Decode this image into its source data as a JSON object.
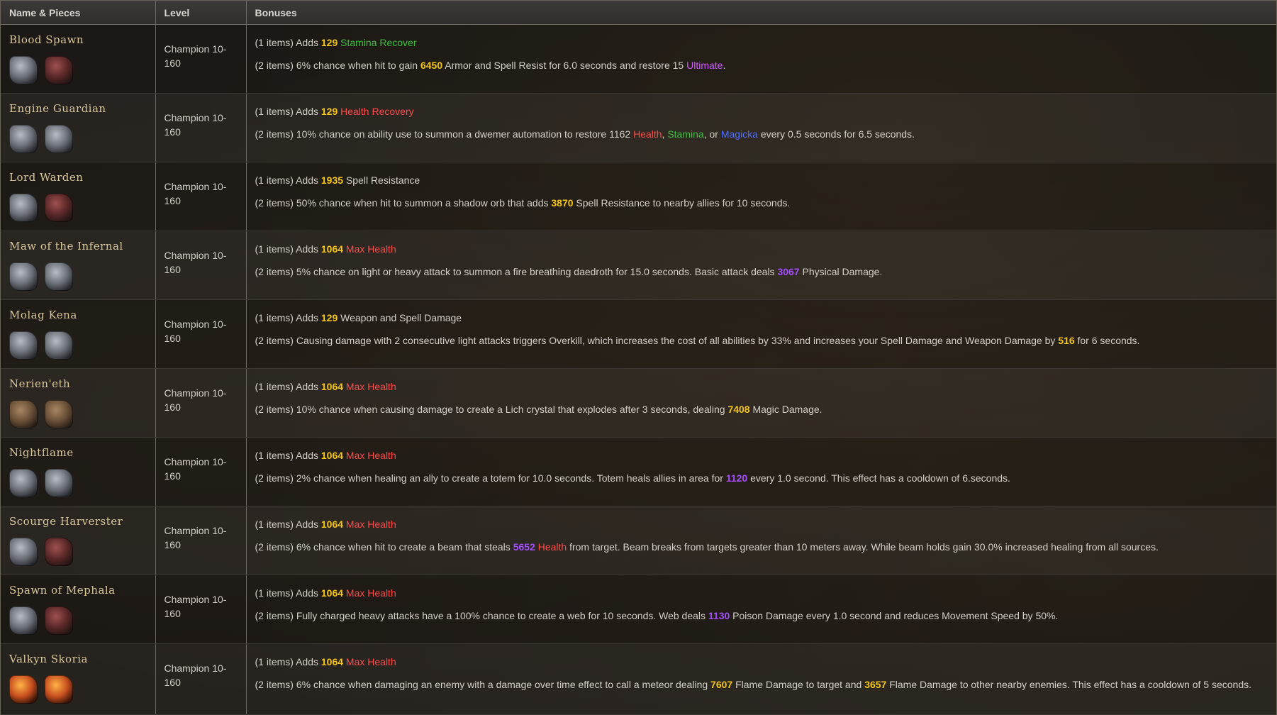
{
  "headers": {
    "name": "Name & Pieces",
    "level": "Level",
    "bonuses": "Bonuses"
  },
  "colors": {
    "number": "#f5c518",
    "number_alt": "#a44dff",
    "stamina": "#3fbf3f",
    "health": "#ff4a4a",
    "magicka": "#4f6bff",
    "ultimate": "#d05bff",
    "set_name": "#d9c79a"
  },
  "sets": [
    {
      "name": "Blood Spawn",
      "level": "Champion 10-160",
      "pieces": [
        {
          "icon": "helm-icon",
          "tone": "steel"
        },
        {
          "icon": "shoulder-icon",
          "tone": "red"
        }
      ],
      "bonuses": [
        [
          {
            "t": "(1 items) Adds "
          },
          {
            "t": "129",
            "c": "num"
          },
          {
            "t": " "
          },
          {
            "t": "Stamina Recover",
            "c": "t-green"
          }
        ],
        [
          {
            "t": "(2 items) 6% chance when hit to gain "
          },
          {
            "t": "6450",
            "c": "num"
          },
          {
            "t": " Armor and Spell Resist for 6.0 seconds and restore 15 "
          },
          {
            "t": "Ultimate",
            "c": "t-magenta"
          },
          {
            "t": "."
          }
        ]
      ]
    },
    {
      "name": "Engine Guardian",
      "level": "Champion 10-160",
      "pieces": [
        {
          "icon": "helm-icon",
          "tone": "steel"
        },
        {
          "icon": "shoulder-icon",
          "tone": "steel"
        }
      ],
      "bonuses": [
        [
          {
            "t": "(1 items) Adds "
          },
          {
            "t": "129",
            "c": "num"
          },
          {
            "t": " "
          },
          {
            "t": "Health Recovery",
            "c": "t-red"
          }
        ],
        [
          {
            "t": "(2 items) 10% chance on ability use to summon a dwemer automation to restore 1162 "
          },
          {
            "t": "Health",
            "c": "t-red"
          },
          {
            "t": ", "
          },
          {
            "t": "Stamina",
            "c": "t-green"
          },
          {
            "t": ", or "
          },
          {
            "t": "Magicka",
            "c": "t-blue"
          },
          {
            "t": " every 0.5 seconds for 6.5 seconds."
          }
        ]
      ]
    },
    {
      "name": "Lord Warden",
      "level": "Champion 10-160",
      "pieces": [
        {
          "icon": "helm-icon",
          "tone": "steel"
        },
        {
          "icon": "shoulder-icon",
          "tone": "red"
        }
      ],
      "bonuses": [
        [
          {
            "t": "(1 items) Adds "
          },
          {
            "t": "1935",
            "c": "num"
          },
          {
            "t": " Spell Resistance"
          }
        ],
        [
          {
            "t": "(2 items) 50% chance when hit to summon a shadow orb that adds "
          },
          {
            "t": "3870",
            "c": "num"
          },
          {
            "t": " Spell Resistance to nearby allies for 10 seconds."
          }
        ]
      ]
    },
    {
      "name": "Maw of the Infernal",
      "level": "Champion 10-160",
      "pieces": [
        {
          "icon": "helm-icon",
          "tone": "steel"
        },
        {
          "icon": "shoulder-icon",
          "tone": "steel"
        }
      ],
      "bonuses": [
        [
          {
            "t": "(1 items) Adds "
          },
          {
            "t": "1064",
            "c": "num"
          },
          {
            "t": " "
          },
          {
            "t": "Max Health",
            "c": "t-red"
          }
        ],
        [
          {
            "t": "(2 items) 5% chance on light or heavy attack to summon a fire breathing daedroth for 15.0 seconds. Basic attack deals "
          },
          {
            "t": "3067",
            "c": "num-purple"
          },
          {
            "t": " Physical Damage."
          }
        ]
      ]
    },
    {
      "name": "Molag Kena",
      "level": "Champion 10-160",
      "pieces": [
        {
          "icon": "helm-icon",
          "tone": "steel"
        },
        {
          "icon": "shoulder-icon",
          "tone": "steel"
        }
      ],
      "bonuses": [
        [
          {
            "t": "(1 items) Adds "
          },
          {
            "t": "129",
            "c": "num"
          },
          {
            "t": " Weapon and Spell Damage"
          }
        ],
        [
          {
            "t": "(2 items) Causing damage with 2 consecutive light attacks triggers Overkill, which increases the cost of all abilities by 33% and increases your Spell Damage and Weapon Damage by "
          },
          {
            "t": "516",
            "c": "num"
          },
          {
            "t": " for 6 seconds."
          }
        ]
      ]
    },
    {
      "name": "Nerien'eth",
      "level": "Champion 10-160",
      "pieces": [
        {
          "icon": "helm-icon",
          "tone": "brown"
        },
        {
          "icon": "shoulder-icon",
          "tone": "brown"
        }
      ],
      "bonuses": [
        [
          {
            "t": "(1 items) Adds "
          },
          {
            "t": "1064",
            "c": "num"
          },
          {
            "t": " "
          },
          {
            "t": "Max Health",
            "c": "t-red"
          }
        ],
        [
          {
            "t": "(2 items) 10% chance when causing damage to create a Lich crystal that explodes after 3 seconds, dealing "
          },
          {
            "t": "7408",
            "c": "num"
          },
          {
            "t": " Magic Damage."
          }
        ]
      ]
    },
    {
      "name": "Nightflame",
      "level": "Champion 10-160",
      "pieces": [
        {
          "icon": "helm-icon",
          "tone": "steel"
        },
        {
          "icon": "shoulder-icon",
          "tone": "steel"
        }
      ],
      "bonuses": [
        [
          {
            "t": "(1 items) Adds "
          },
          {
            "t": "1064",
            "c": "num"
          },
          {
            "t": " "
          },
          {
            "t": "Max Health",
            "c": "t-red"
          }
        ],
        [
          {
            "t": "(2 items) 2% chance when healing an ally to create a totem for 10.0 seconds. Totem heals allies in area for "
          },
          {
            "t": "1120",
            "c": "num-purple"
          },
          {
            "t": " every 1.0 second. This effect has a cooldown of 6.seconds."
          }
        ]
      ]
    },
    {
      "name": "Scourge Harverster",
      "level": "Champion 10-160",
      "pieces": [
        {
          "icon": "helm-icon",
          "tone": "steel"
        },
        {
          "icon": "shoulder-icon",
          "tone": "red"
        }
      ],
      "bonuses": [
        [
          {
            "t": "(1 items) Adds "
          },
          {
            "t": "1064",
            "c": "num"
          },
          {
            "t": " "
          },
          {
            "t": "Max Health",
            "c": "t-red"
          }
        ],
        [
          {
            "t": "(2 items) 6% chance when hit to create a beam that steals "
          },
          {
            "t": "5652",
            "c": "num-purple"
          },
          {
            "t": " "
          },
          {
            "t": "Health",
            "c": "t-red"
          },
          {
            "t": " from target. Beam breaks from targets greater than 10 meters away. While beam holds gain 30.0% increased healing from all sources."
          }
        ]
      ]
    },
    {
      "name": "Spawn of Mephala",
      "level": "Champion 10-160",
      "pieces": [
        {
          "icon": "helm-icon",
          "tone": "steel"
        },
        {
          "icon": "shoulder-icon",
          "tone": "red"
        }
      ],
      "bonuses": [
        [
          {
            "t": "(1 items) Adds "
          },
          {
            "t": "1064",
            "c": "num"
          },
          {
            "t": " "
          },
          {
            "t": "Max Health",
            "c": "t-red"
          }
        ],
        [
          {
            "t": "(2 items) Fully charged heavy attacks have a 100% chance to create a web for 10 seconds. Web deals "
          },
          {
            "t": "1130",
            "c": "num-purple"
          },
          {
            "t": " Poison Damage every 1.0 second and reduces Movement Speed by 50%."
          }
        ]
      ]
    },
    {
      "name": "Valkyn Skoria",
      "level": "Champion 10-160",
      "pieces": [
        {
          "icon": "helm-icon",
          "tone": "fire"
        },
        {
          "icon": "shoulder-icon",
          "tone": "fire"
        }
      ],
      "bonuses": [
        [
          {
            "t": "(1 items) Adds "
          },
          {
            "t": "1064",
            "c": "num"
          },
          {
            "t": " "
          },
          {
            "t": "Max Health",
            "c": "t-red"
          }
        ],
        [
          {
            "t": "(2 items) 6% chance when damaging an enemy with a damage over time effect to call a meteor dealing "
          },
          {
            "t": "7607",
            "c": "num"
          },
          {
            "t": " Flame Damage to target and "
          },
          {
            "t": "3657",
            "c": "num"
          },
          {
            "t": " Flame Damage to other nearby enemies. This effect has a cooldown of 5 seconds."
          }
        ]
      ]
    }
  ]
}
